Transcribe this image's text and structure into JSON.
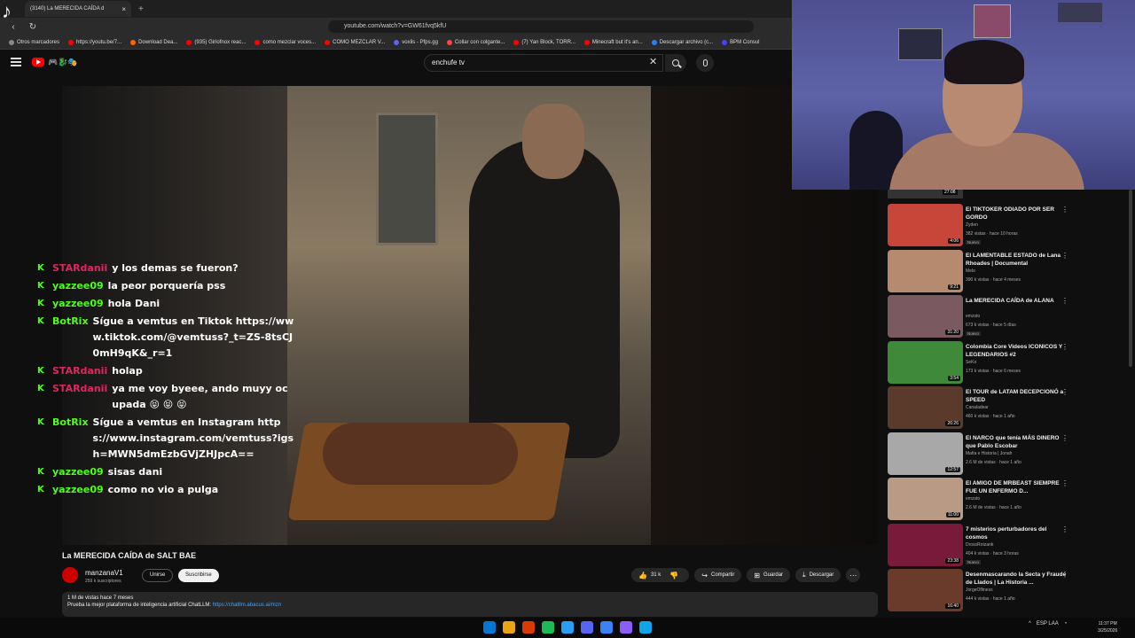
{
  "browser": {
    "tab_title": "(3140) La MERECIDA CAÍDA d",
    "tab_close": "×",
    "new_tab": "+",
    "url": "youtube.com/watch?v=GW61fvq5kfU",
    "bookmarks": [
      {
        "label": "Otros marcadores",
        "color": "#888888"
      },
      {
        "label": "https://youtu.be/7...",
        "color": "#ff0000"
      },
      {
        "label": "Download Dea...",
        "color": "#ff6600"
      },
      {
        "label": "(935) Girlofnox reac...",
        "color": "#ff0000"
      },
      {
        "label": "como mezclar voces...",
        "color": "#ff0000"
      },
      {
        "label": "COMO MEZCLAR V...",
        "color": "#ff0000"
      },
      {
        "label": "voxlis - Pfps.gg",
        "color": "#5865f2"
      },
      {
        "label": "Collar con colgante...",
        "color": "#ff4444"
      },
      {
        "label": "(7) Yan Block, TORR...",
        "color": "#ff0000"
      },
      {
        "label": "Minecraft but it's an...",
        "color": "#ff0000"
      },
      {
        "label": "Descargar archivo (c...",
        "color": "#2a7fff"
      },
      {
        "label": "BPM Consul",
        "color": "#4444ff"
      }
    ]
  },
  "youtube": {
    "search_value": "enchufe tv",
    "logo_extra": "🎮🐉🎭"
  },
  "chat": [
    {
      "user": "STARdanii",
      "user_class": "u-star",
      "badge": "K",
      "msg": "y los demas se fueron?"
    },
    {
      "user": "yazzee09",
      "user_class": "u-yazzee",
      "badge": "K",
      "msg": "la peor porquería pss"
    },
    {
      "user": "yazzee09",
      "user_class": "u-yazzee",
      "badge": "K",
      "msg": "hola Dani"
    },
    {
      "user": "BotRix",
      "user_class": "u-bot",
      "badge": "K",
      "msg": "Sígue a vemtus en Tiktok https://www.tiktok.com/@vemtuss?_t=ZS-8tsCJ0mH9qK&_r=1"
    },
    {
      "user": "STARdanii",
      "user_class": "u-star",
      "badge": "K",
      "msg": "holap"
    },
    {
      "user": "STARdanii",
      "user_class": "u-star",
      "badge": "K",
      "msg": "ya me voy byeee, ando muyy ocupada 😝 😝 😝"
    },
    {
      "user": "BotRix",
      "user_class": "u-bot",
      "badge": "K",
      "msg": "Sígue a vemtus en Instagram https://www.instagram.com/vemtuss?igsh=MWN5dmEzbGVjZHJpcA=="
    },
    {
      "user": "yazzee09",
      "user_class": "u-yazzee",
      "badge": "K",
      "msg": "sisas dani"
    },
    {
      "user": "yazzee09",
      "user_class": "u-yazzee",
      "badge": "K",
      "msg": "como no vio a pulga"
    }
  ],
  "video": {
    "title": "La MERECIDA CAÍDA de SALT BAE",
    "channel": "manzanaV1",
    "subscribers": "259 k suscriptores",
    "join_label": "Unirse",
    "subscribe_label": "Suscribirse",
    "likes": "31 k",
    "share_label": "Compartir",
    "save_label": "Guardar",
    "download_label": "Descargar",
    "more": "⋯",
    "meta": "1 M de vistas  hace 7 meses",
    "desc_prefix": "Prueba la mejor plataforma de inteligencia artificial ChatLLM: ",
    "desc_link": "https://chatllm.abacus.ai/mzn"
  },
  "recommendations": [
    {
      "title": "El TIKTOKER ODIADO POR SER GORDO",
      "channel": "Zyden",
      "views": "382 vistas · hace 10 horas",
      "duration": "4:06",
      "badge": "Nuevo",
      "thumb_color": "#c8453a"
    },
    {
      "title": "El LAMENTABLE ESTADO de Lana Rhoades | Documental",
      "channel": "Melo",
      "views": "390 k vistas · hace 4 meses",
      "duration": "9:21",
      "badge": "",
      "thumb_color": "#b58a6e"
    },
    {
      "title": "La MERECIDA CAÍDA de ALANA",
      "channel": "emzsto",
      "views": "673 k vistas · hace 5 días",
      "duration": "31:20",
      "badge": "Nuevo",
      "thumb_color": "#7a5a60"
    },
    {
      "title": "Colombia Core Videos ICONICOS Y LEGENDARIOS #2",
      "channel": "SeKo",
      "views": "173 k vistas · hace 6 meses",
      "duration": "3:54",
      "badge": "",
      "thumb_color": "#3f8a3a"
    },
    {
      "title": "El TOUR de LATAM DECEPCIONÓ a SPEED",
      "channel": "Canaladear",
      "views": "460 k vistas · hace 1 año",
      "duration": "26:26",
      "badge": "",
      "thumb_color": "#5a3a2a"
    },
    {
      "title": "El NARCO que tenía MÁS DINERO que Pablo Escobar",
      "channel": "Mafia e Historia | Jonah",
      "views": "2.6 M de vistas · hace 1 año",
      "duration": "12:57",
      "badge": "",
      "thumb_color": "#a8a8a8"
    },
    {
      "title": "El AMIGO DE MRBEAST SIEMPRE FUE UN ENFERMO D...",
      "channel": "emzsto",
      "views": "2.6 M de vistas · hace 1 año",
      "duration": "11:00",
      "badge": "",
      "thumb_color": "#b89a85"
    },
    {
      "title": "7 misterios perturbadores del cosmos",
      "channel": "DrossRotzank",
      "views": "404 k vistas · hace 3 horas",
      "duration": "23:38",
      "badge": "Nuevo",
      "thumb_color": "#7a1a3a"
    },
    {
      "title": "Desenmascarando la Secta y Fraude de Llados | La Historia ...",
      "channel": "JorgeOfliness",
      "views": "444 k vistas · hace 1 año",
      "duration": "16:40",
      "badge": "",
      "thumb_color": "#6a3a2a"
    }
  ],
  "partial_duration": "27:08",
  "taskbar": {
    "lang": "ESP LAA",
    "time": "11:37 PM",
    "date": "3/25/2026",
    "icons": [
      "#0078d4",
      "#e8a317",
      "#d83b01",
      "#1db954",
      "#2a9df4",
      "#5865f2",
      "#3b82f6",
      "#8b5cf6",
      "#0ea5e9"
    ]
  }
}
